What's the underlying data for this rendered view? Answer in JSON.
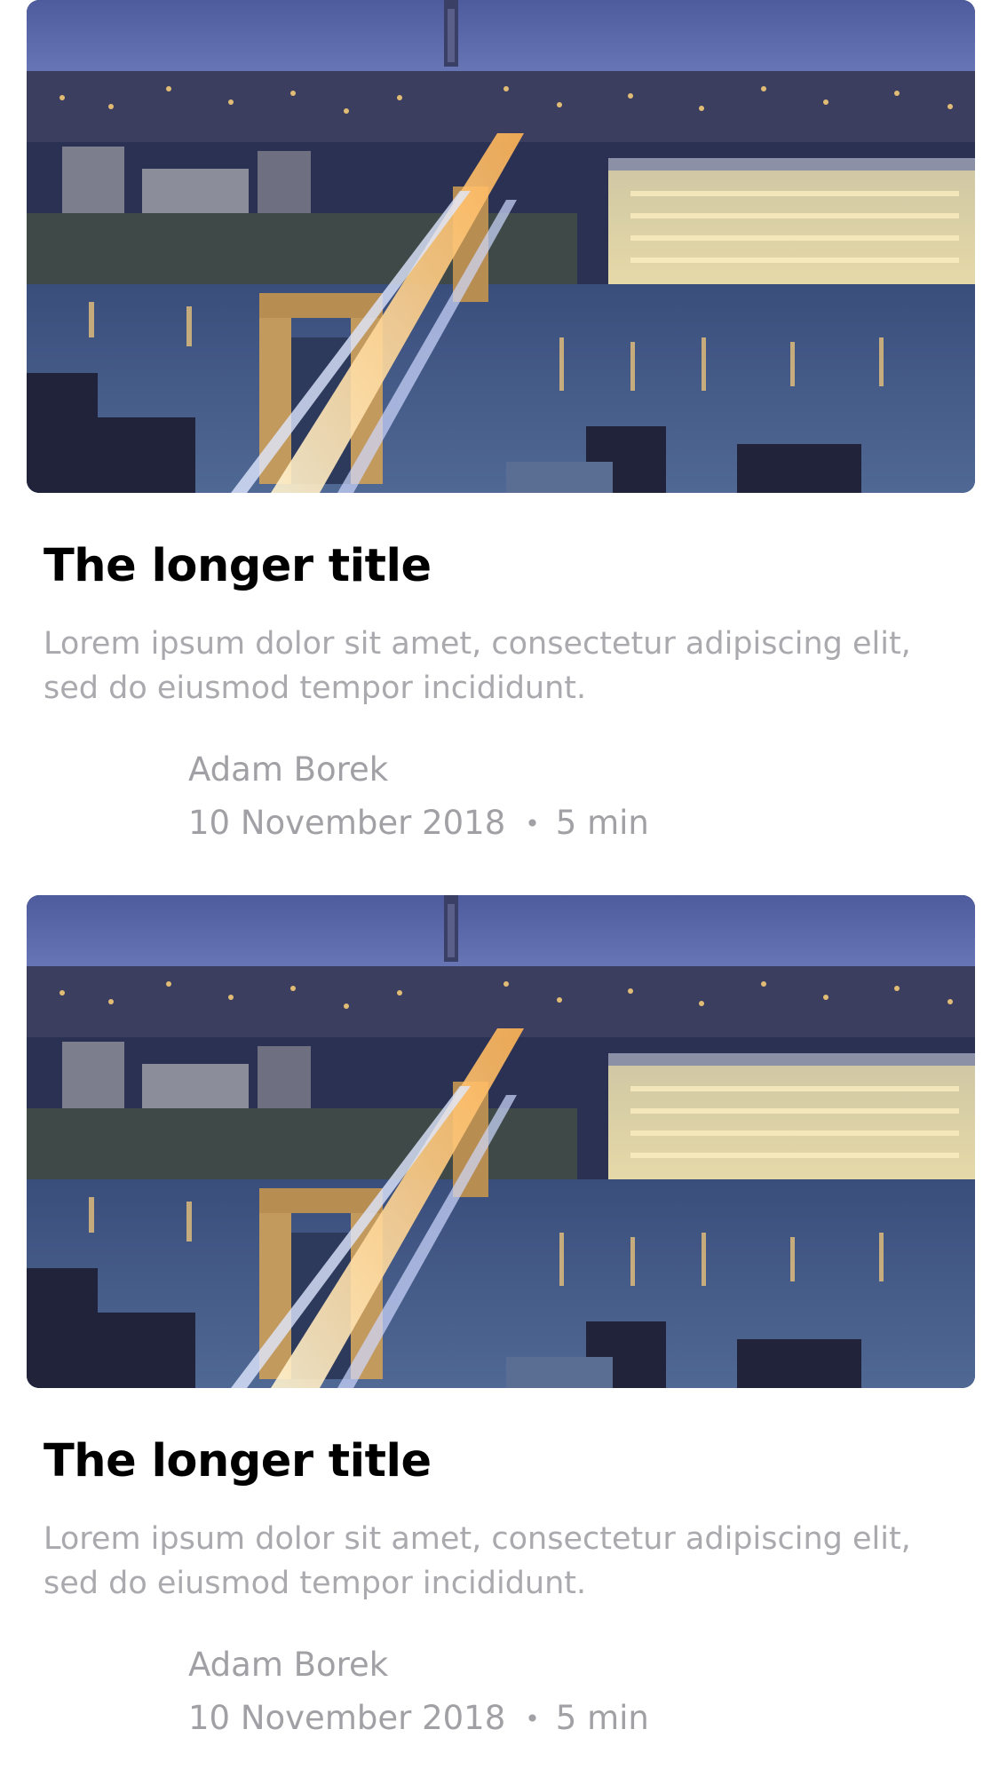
{
  "articles": [
    {
      "image": "city-bridge-night-photo",
      "title": "The longer title",
      "excerpt": "Lorem ipsum dolor sit amet, consectetur adipiscing elit, sed do eiusmod tempor incididunt.",
      "author": "Adam Borek",
      "date": "10 November 2018",
      "separator": "•",
      "read_time": "5 min"
    },
    {
      "image": "city-bridge-night-photo",
      "title": "The longer title",
      "excerpt": "Lorem ipsum dolor sit amet, consectetur adipiscing elit, sed do eiusmod tempor incididunt.",
      "author": "Adam Borek",
      "date": "10 November 2018",
      "separator": "•",
      "read_time": "5 min"
    }
  ],
  "colors": {
    "title": "#000000",
    "excerpt": "#a9a9ae",
    "meta": "#a0a0a5",
    "background": "#ffffff"
  }
}
